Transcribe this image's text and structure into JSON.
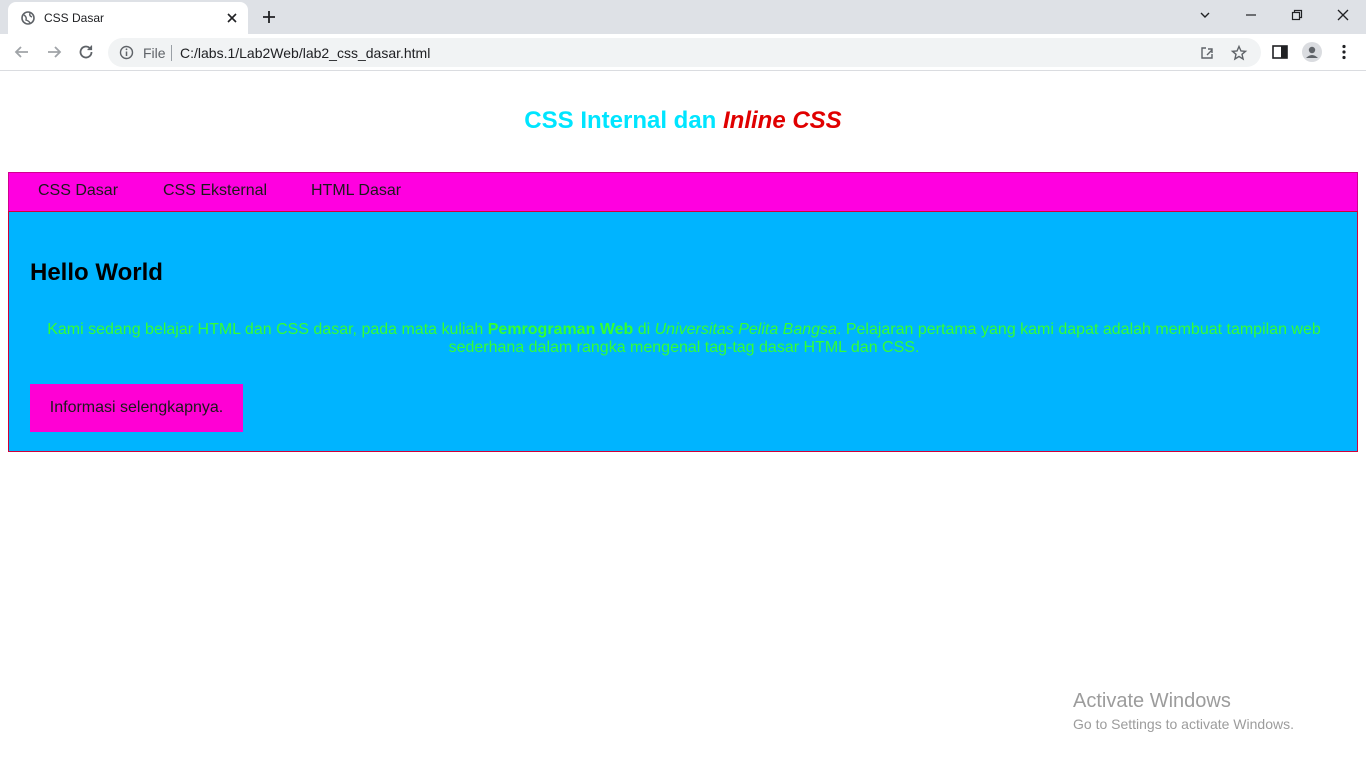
{
  "browser": {
    "tab_title": "CSS Dasar",
    "omnibox": {
      "file_label": "File",
      "url": "C:/labs.1/Lab2Web/lab2_css_dasar.html"
    }
  },
  "page": {
    "title_part1": "CSS Internal dan ",
    "title_part2": "Inline CSS",
    "title_colors": {
      "part1": "#00e5ff",
      "part2": "#e00000"
    },
    "menu": {
      "background": "#ff00e0",
      "items": [
        {
          "label": "CSS Dasar"
        },
        {
          "label": "CSS Eksternal"
        },
        {
          "label": "HTML Dasar"
        }
      ]
    },
    "content": {
      "background": "#00b4ff",
      "heading": "Hello World",
      "paragraph": {
        "text_before": "Kami sedang belajar HTML dan CSS dasar, pada mata kuliah ",
        "bold": "Pemrograman Web",
        "text_middle": " di ",
        "italic": "Universitas Pelita Bangsa",
        "text_after": ". Pelajaran pertama yang kami dapat adalah membuat tampilan web sederhana dalam rangka mengenal tag-tag dasar HTML dan CSS.",
        "color": "#33ff33"
      },
      "button_label": "Informasi selengkapnya."
    }
  },
  "watermark": {
    "title": "Activate Windows",
    "subtitle": "Go to Settings to activate Windows."
  }
}
